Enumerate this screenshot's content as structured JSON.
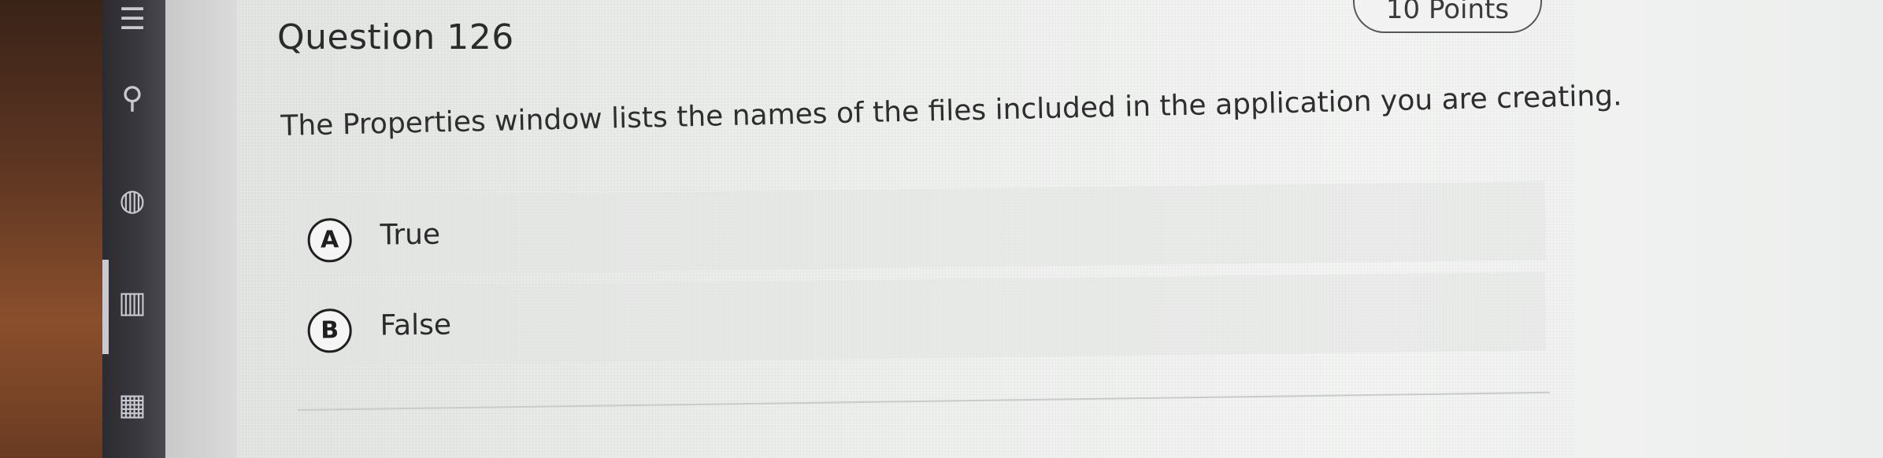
{
  "question": {
    "title": "Question 126",
    "points": "10 Points",
    "text": "The Properties window lists the names of the files included in the application you are creating."
  },
  "options": [
    {
      "letter": "A",
      "label": "True"
    },
    {
      "letter": "B",
      "label": "False"
    }
  ],
  "rail_icons": [
    "menu-icon",
    "search-icon",
    "globe-icon",
    "book-icon",
    "calendar-icon"
  ]
}
